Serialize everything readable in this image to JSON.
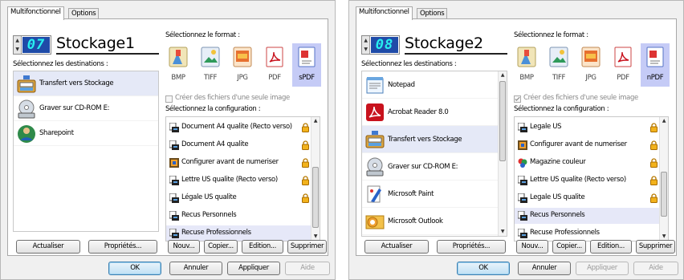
{
  "windows": [
    {
      "tabs": [
        "Multifonctionnel",
        "Options"
      ],
      "counter": "07",
      "title": "Stockage1",
      "format_label": "Sélectionnez le format :",
      "dest_label": "Sélectionnez les destinations :",
      "destinations": [
        {
          "label": "Transfert vers Stockage",
          "icon": "storage-transfer-icon",
          "selected": true
        },
        {
          "label": "Graver sur CD-ROM  E:",
          "icon": "cd-burner-icon",
          "selected": false
        },
        {
          "label": "Sharepoint",
          "icon": "sharepoint-icon",
          "selected": false
        }
      ],
      "formats": [
        {
          "label": "BMP",
          "icon": "bmp-icon",
          "selected": false
        },
        {
          "label": "TIFF",
          "icon": "tiff-icon",
          "selected": false
        },
        {
          "label": "JPG",
          "icon": "jpg-icon",
          "selected": false
        },
        {
          "label": "PDF",
          "icon": "pdf-icon",
          "selected": false
        },
        {
          "label": "sPDF",
          "icon": "spdf-icon",
          "selected": true
        }
      ],
      "single_file_label": "Créer des fichiers d'une seule image",
      "single_file_checked": false,
      "config_label": "Sélectionnez la configuration :",
      "configs": [
        {
          "label": "Document A4 qualite (Recto verso)",
          "icon": "scanner-icon",
          "lock": true,
          "selected": false
        },
        {
          "label": "Document A4 qualite",
          "icon": "scanner-icon",
          "lock": true,
          "selected": false
        },
        {
          "label": "Configurer avant de numeriser",
          "icon": "configure-icon",
          "lock": true,
          "selected": false
        },
        {
          "label": "Lettre US qualite (Recto verso)",
          "icon": "scanner-icon",
          "lock": true,
          "selected": false
        },
        {
          "label": "Légale US qualite",
          "icon": "scanner-icon",
          "lock": true,
          "selected": false
        },
        {
          "label": "Recus Personnels",
          "icon": "scanner-icon",
          "lock": false,
          "selected": false
        },
        {
          "label": "Recuse Professionnels",
          "icon": "scanner-icon",
          "lock": false,
          "selected": true
        }
      ],
      "left_buttons": [
        "Actualiser",
        "Propriétés..."
      ],
      "right_buttons": [
        "Nouv...",
        "Copier...",
        "Edition...",
        "Supprimer"
      ],
      "bottom_buttons": [
        {
          "label": "OK",
          "state": "default"
        },
        {
          "label": "Annuler",
          "state": "normal"
        },
        {
          "label": "Appliquer",
          "state": "normal"
        },
        {
          "label": "Aide",
          "state": "disabled"
        }
      ]
    },
    {
      "tabs": [
        "Multifonctionnel",
        "Options"
      ],
      "counter": "08",
      "title": "Stockage2",
      "format_label": "Sélectionnez le format :",
      "dest_label": "Sélectionnez les destinations :",
      "destinations": [
        {
          "label": "Notepad",
          "icon": "notepad-icon",
          "selected": false
        },
        {
          "label": "Acrobat Reader 8.0",
          "icon": "acrobat-icon",
          "selected": false
        },
        {
          "label": "Transfert vers Stockage",
          "icon": "storage-transfer-icon",
          "selected": true
        },
        {
          "label": "Graver sur CD-ROM  E:",
          "icon": "cd-burner-icon",
          "selected": false
        },
        {
          "label": "Microsoft Paint",
          "icon": "paint-icon",
          "selected": false
        },
        {
          "label": "Microsoft Outlook",
          "icon": "outlook-icon",
          "selected": false
        }
      ],
      "formats": [
        {
          "label": "BMP",
          "icon": "bmp-icon",
          "selected": false
        },
        {
          "label": "TIFF",
          "icon": "tiff-icon",
          "selected": false
        },
        {
          "label": "JPG",
          "icon": "jpg-icon",
          "selected": false
        },
        {
          "label": "PDF",
          "icon": "pdf-icon",
          "selected": false
        },
        {
          "label": "nPDF",
          "icon": "npdf-icon",
          "selected": true
        }
      ],
      "single_file_label": "Créer des fichiers d'une seule image",
      "single_file_checked": true,
      "config_label": "Sélectionnez la configuration :",
      "configs": [
        {
          "label": "Legale US",
          "icon": "scanner-icon",
          "lock": true,
          "selected": false
        },
        {
          "label": "Configurer avant de numeriser",
          "icon": "configure-icon",
          "lock": true,
          "selected": false
        },
        {
          "label": "Magazine couleur",
          "icon": "color-icon",
          "lock": true,
          "selected": false
        },
        {
          "label": "Lettre US qualite (Recto verso)",
          "icon": "scanner-icon",
          "lock": true,
          "selected": false
        },
        {
          "label": "Legale US qualite",
          "icon": "scanner-icon",
          "lock": true,
          "selected": false
        },
        {
          "label": "Recus Personnels",
          "icon": "scanner-icon",
          "lock": false,
          "selected": true
        },
        {
          "label": "Recuse Professionnels",
          "icon": "scanner-icon",
          "lock": false,
          "selected": false
        }
      ],
      "left_buttons": [
        "Actualiser",
        "Propriétés..."
      ],
      "right_buttons": [
        "Nouv...",
        "Copier...",
        "Edition...",
        "Supprimer"
      ],
      "bottom_buttons": [
        {
          "label": "OK",
          "state": "default"
        },
        {
          "label": "Annuler",
          "state": "normal"
        },
        {
          "label": "Appliquer",
          "state": "disabled"
        },
        {
          "label": "Aide",
          "state": "disabled"
        }
      ]
    }
  ]
}
